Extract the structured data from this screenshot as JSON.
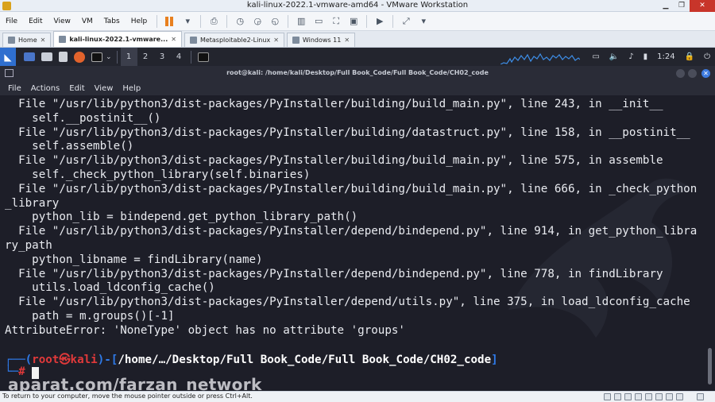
{
  "window": {
    "title": "kali-linux-2022.1-vmware-amd64 - VMware Workstation"
  },
  "menu": [
    "File",
    "Edit",
    "View",
    "VM",
    "Tabs",
    "Help"
  ],
  "tabs": [
    {
      "label": "Home",
      "active": false
    },
    {
      "label": "kali-linux-2022.1-vmware...",
      "active": true
    },
    {
      "label": "Metasploitable2-Linux",
      "active": false
    },
    {
      "label": "Windows 11",
      "active": false
    }
  ],
  "kali_panel": {
    "workspaces": [
      "1",
      "2",
      "3",
      "4"
    ],
    "clock": "1:24"
  },
  "terminal": {
    "title": "root@kali: /home/kali/Desktop/Full Book_Code/Full Book_Code/CH02_code",
    "menu": [
      "File",
      "Actions",
      "Edit",
      "View",
      "Help"
    ],
    "lines": [
      "  File \"/usr/lib/python3/dist-packages/PyInstaller/building/build_main.py\", line 243, in __init__",
      "    self.__postinit__()",
      "  File \"/usr/lib/python3/dist-packages/PyInstaller/building/datastruct.py\", line 158, in __postinit__",
      "    self.assemble()",
      "  File \"/usr/lib/python3/dist-packages/PyInstaller/building/build_main.py\", line 575, in assemble",
      "    self._check_python_library(self.binaries)",
      "  File \"/usr/lib/python3/dist-packages/PyInstaller/building/build_main.py\", line 666, in _check_python",
      "_library",
      "    python_lib = bindepend.get_python_library_path()",
      "  File \"/usr/lib/python3/dist-packages/PyInstaller/depend/bindepend.py\", line 914, in get_python_libra",
      "ry_path",
      "    python_libname = findLibrary(name)",
      "  File \"/usr/lib/python3/dist-packages/PyInstaller/depend/bindepend.py\", line 778, in findLibrary",
      "    utils.load_ldconfig_cache()",
      "  File \"/usr/lib/python3/dist-packages/PyInstaller/depend/utils.py\", line 375, in load_ldconfig_cache",
      "    path = m.groups()[-1]",
      "AttributeError: 'NoneType' object has no attribute 'groups'"
    ],
    "prompt": {
      "open": "┌──(",
      "user": "root㉿kali",
      "mid": ")-[",
      "path": "/home/…/Desktop/Full Book_Code/Full Book_Code/CH02_code",
      "close": "]",
      "line2": "└─",
      "symbol": "#"
    }
  },
  "watermark": "aparat.com/farzan_network",
  "status": {
    "message": "To return to your computer, move the mouse pointer outside or press Ctrl+Alt."
  }
}
